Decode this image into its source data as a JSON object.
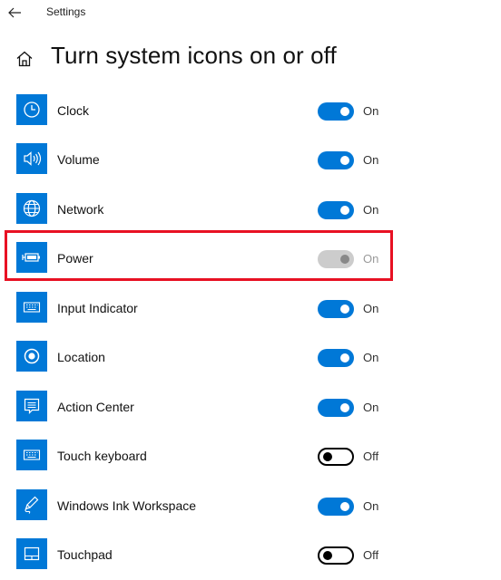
{
  "window": {
    "title": "Settings"
  },
  "page": {
    "title": "Turn system icons on or off"
  },
  "colors": {
    "accent": "#0078d7",
    "highlight": "#e81123",
    "disabled_toggle": "#cccccc"
  },
  "items": [
    {
      "label": "Clock",
      "icon": "clock-icon",
      "state": "On",
      "toggle": "on"
    },
    {
      "label": "Volume",
      "icon": "volume-icon",
      "state": "On",
      "toggle": "on"
    },
    {
      "label": "Network",
      "icon": "globe-icon",
      "state": "On",
      "toggle": "on"
    },
    {
      "label": "Power",
      "icon": "battery-icon",
      "state": "On",
      "toggle": "on",
      "disabled": true,
      "highlighted": true
    },
    {
      "label": "Input Indicator",
      "icon": "keyboard-icon",
      "state": "On",
      "toggle": "on"
    },
    {
      "label": "Location",
      "icon": "location-icon",
      "state": "On",
      "toggle": "on"
    },
    {
      "label": "Action Center",
      "icon": "action-center-icon",
      "state": "On",
      "toggle": "on"
    },
    {
      "label": "Touch keyboard",
      "icon": "keyboard-icon",
      "state": "Off",
      "toggle": "off"
    },
    {
      "label": "Windows Ink Workspace",
      "icon": "pen-icon",
      "state": "On",
      "toggle": "on"
    },
    {
      "label": "Touchpad",
      "icon": "touchpad-icon",
      "state": "Off",
      "toggle": "off"
    }
  ]
}
